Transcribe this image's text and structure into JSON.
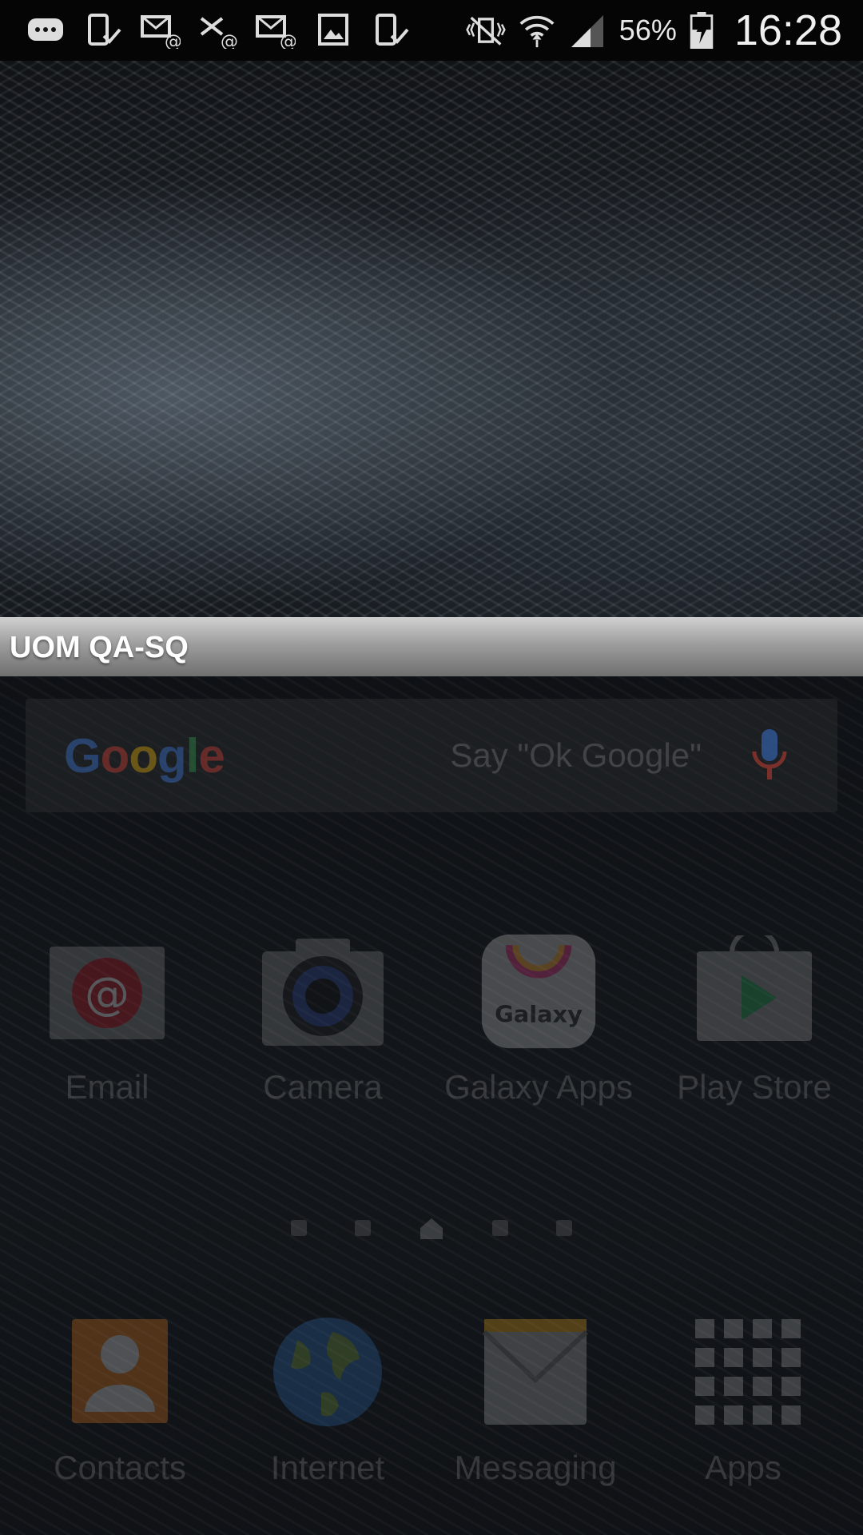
{
  "status_bar": {
    "battery_percent": "56%",
    "clock": "16:28",
    "left_icons": [
      "more-notifications-icon",
      "device-check-icon",
      "email-at-icon",
      "email-failed-icon",
      "email-at-icon",
      "gallery-icon",
      "device-check-icon"
    ],
    "right_icons": [
      "vibrate-mute-icon",
      "wifi-icon",
      "signal-icon",
      "battery-charging-icon"
    ]
  },
  "overlay": {
    "title": "UOM QA-SQ"
  },
  "search": {
    "logo": "Google",
    "placeholder": "Say \"Ok Google\""
  },
  "apps": [
    {
      "label": "Email",
      "icon": "email-app-icon"
    },
    {
      "label": "Camera",
      "icon": "camera-app-icon"
    },
    {
      "label": "Galaxy Apps",
      "icon": "galaxy-apps-icon",
      "icon_text": "Galaxy"
    },
    {
      "label": "Play Store",
      "icon": "play-store-icon"
    }
  ],
  "dock": [
    {
      "label": "Contacts",
      "icon": "contacts-app-icon"
    },
    {
      "label": "Internet",
      "icon": "internet-app-icon"
    },
    {
      "label": "Messaging",
      "icon": "messaging-app-icon"
    },
    {
      "label": "Apps",
      "icon": "apps-grid-icon"
    }
  ],
  "colors": {
    "status_bar_bg": "#050505",
    "overlay_bar": "#9c9c9c",
    "google_blue": "#4285F4",
    "google_red": "#EA4335",
    "google_yellow": "#FBBC05",
    "google_green": "#34A853"
  }
}
